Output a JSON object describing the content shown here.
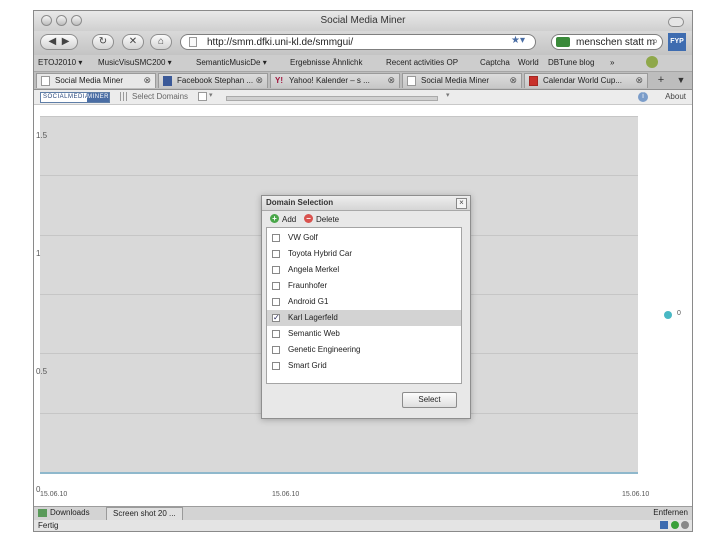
{
  "window": {
    "title": "Social Media Miner"
  },
  "nav": {
    "url": "http://smm.dfki.uni-kl.de/smmgui/",
    "search_value": "menschen statt m",
    "addon_label": "FYP"
  },
  "bookmarks": [
    "ETOJ2010 ▾",
    "MusicVisuSMC200 ▾",
    "SemanticMusicDe ▾",
    "Ergebnisse Ähnlichk",
    "Recent activities OP",
    "Captcha",
    "World",
    "DBTune blog",
    "»"
  ],
  "tabs": [
    {
      "label": "Social Media Miner",
      "active": true
    },
    {
      "label": "Facebook  Stephan ...",
      "active": false
    },
    {
      "label": "Yahoo! Kalender – s ...",
      "active": false
    },
    {
      "label": "Social Media Miner",
      "active": false
    },
    {
      "label": "Calendar World Cup...",
      "active": false
    }
  ],
  "app": {
    "logo_left": "SOCIALMEDIA",
    "logo_right": "MINER",
    "select_domains": "Select Domains",
    "about": "About"
  },
  "chart_data": {
    "type": "line",
    "y_ticks": [
      "1.5",
      "1",
      "0.5",
      "0"
    ],
    "ylim": [
      0,
      1.5
    ],
    "x_ticks": [
      "15.06.10",
      "15.06.10",
      "15.06.10"
    ],
    "series": [
      {
        "name": "0",
        "values": [
          0,
          0,
          0
        ]
      }
    ],
    "legend_position": "right",
    "colors": {
      "series": "#49b8c4",
      "axis": "#8fb8cc",
      "plot_bg": "#d9d9d9"
    }
  },
  "dialog": {
    "title": "Domain Selection",
    "add_label": "Add",
    "delete_label": "Delete",
    "items": [
      {
        "label": "VW Golf",
        "checked": false
      },
      {
        "label": "Toyota Hybrid Car",
        "checked": false
      },
      {
        "label": "Angela Merkel",
        "checked": false
      },
      {
        "label": "Fraunhofer",
        "checked": false
      },
      {
        "label": "Android G1",
        "checked": false
      },
      {
        "label": "Karl Lagerfeld",
        "checked": true
      },
      {
        "label": "Semantic Web",
        "checked": false
      },
      {
        "label": "Genetic Engineering",
        "checked": false
      },
      {
        "label": "Smart Grid",
        "checked": false
      }
    ],
    "select_label": "Select"
  },
  "downloads": {
    "label": "Downloads",
    "item": "Screen shot 20 ...",
    "remove": "Entfernen"
  },
  "status": {
    "text": "Fertig"
  }
}
